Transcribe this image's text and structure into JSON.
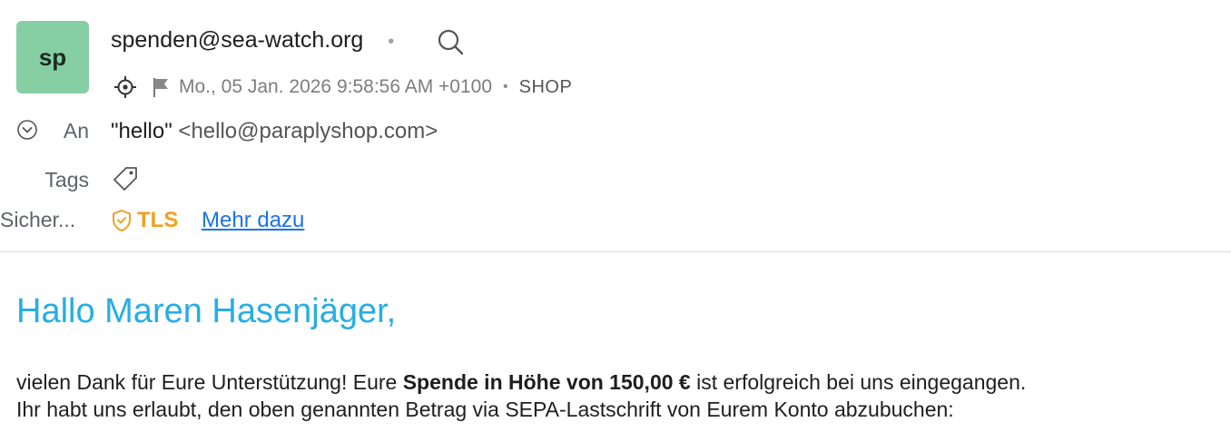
{
  "header": {
    "avatar_initials": "sp",
    "sender": "spenden@sea-watch.org",
    "separator": "•",
    "date": "Mo., 05 Jan. 2026 9:58:56 AM +0100",
    "folder": "SHOP",
    "icons": [
      "search-icon",
      "locate-icon",
      "flag-icon",
      "chevron-down-icon",
      "tag-icon",
      "shield-check-icon"
    ]
  },
  "recipients": {
    "to_label": "An",
    "to_name": "\"hello\"",
    "to_address": "<hello@paraplyshop.com>",
    "tags_label": "Tags",
    "security_label": "Sicher...",
    "security_value": "TLS",
    "more_link": "Mehr dazu"
  },
  "message": {
    "greeting": "Hallo Maren Hasenjäger,",
    "line1_before": "vielen Dank für Eure Unterstützung! Eure ",
    "line1_bold": "Spende in Höhe von 150,00 €",
    "line1_after": " ist erfolgreich bei uns eingegangen.",
    "line2": "Ihr habt uns erlaubt, den oben genannten Betrag via SEPA-Lastschrift von Eurem Konto abzubuchen:"
  },
  "colors": {
    "avatar_bg": "#86cfa4",
    "greeting": "#25aee6",
    "tls": "#f0a020",
    "link": "#1a73e8"
  }
}
